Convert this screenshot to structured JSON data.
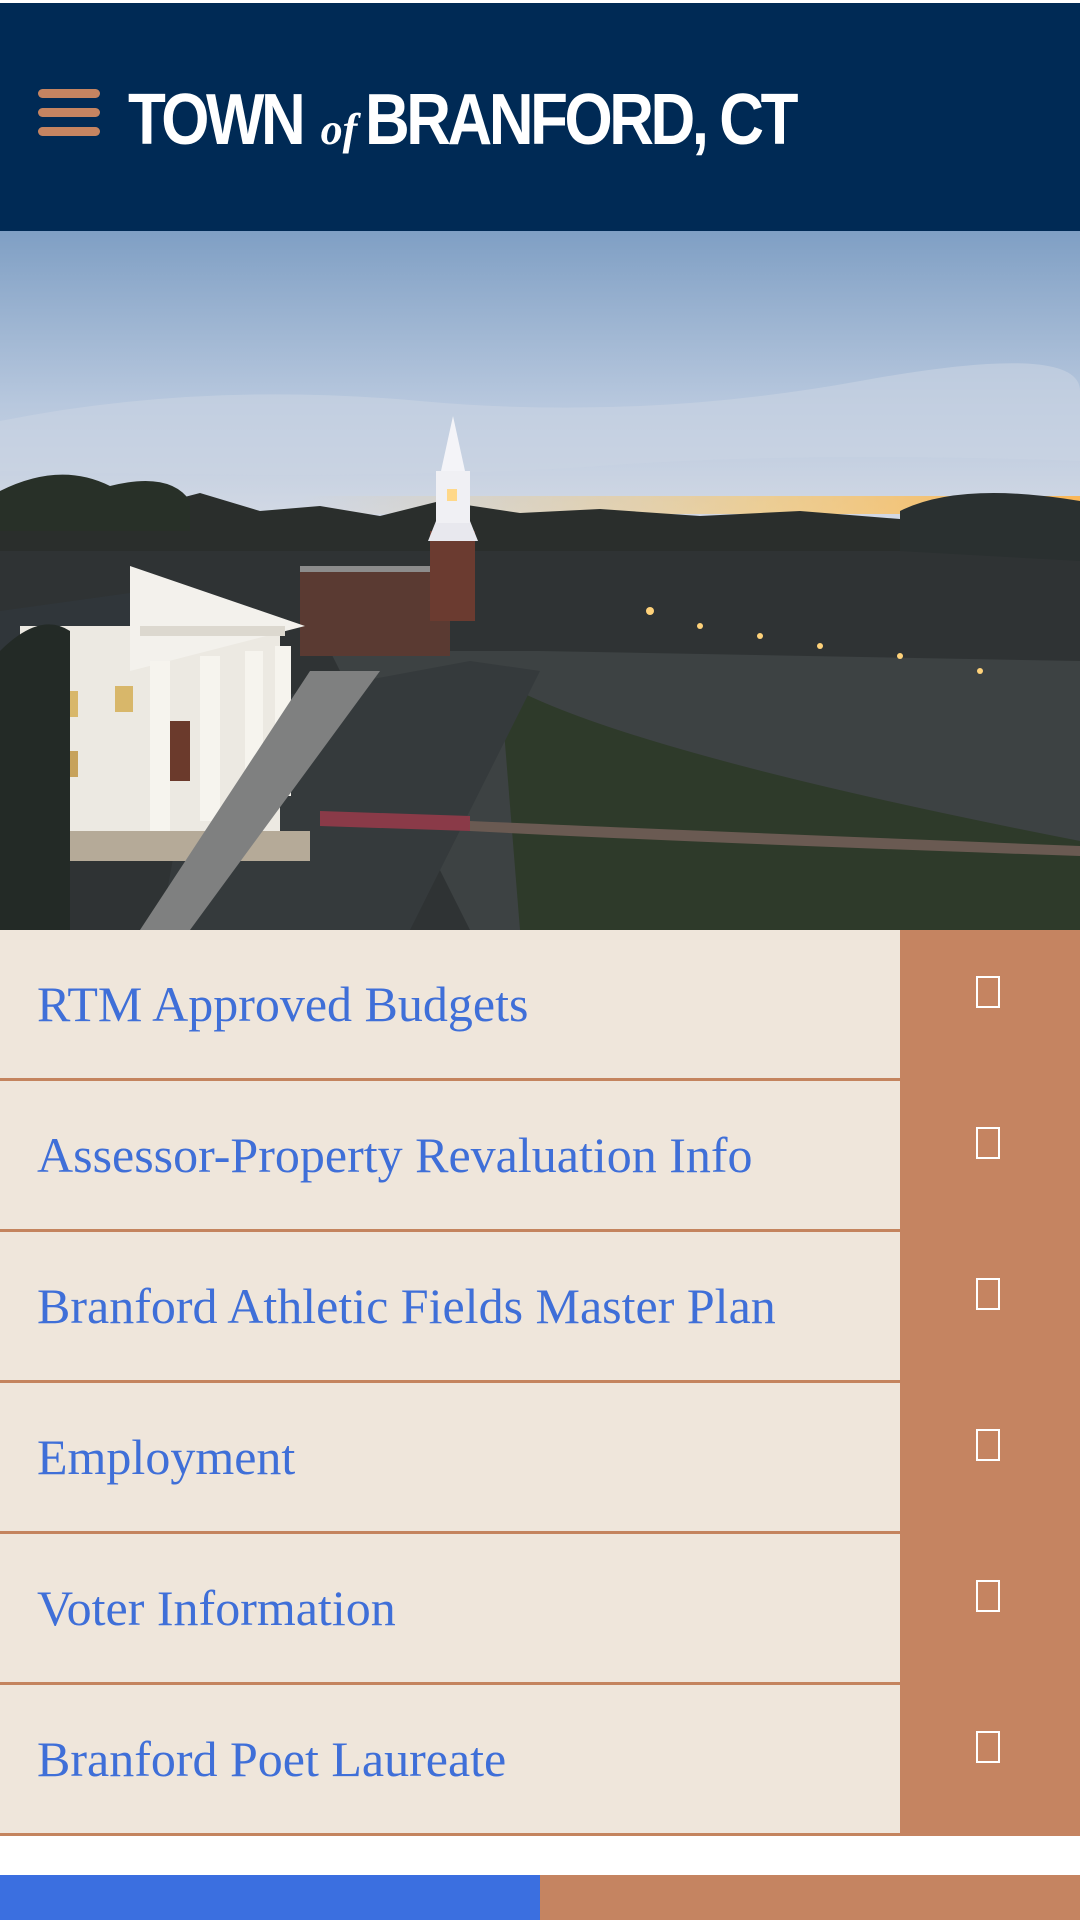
{
  "header": {
    "logo": {
      "town": "TOWN",
      "of": "of",
      "name": "BRANFORD, CT"
    },
    "menu_icon": "hamburger-menu-icon"
  },
  "hero": {
    "alt": "Aerial view of Branford town green at sunset"
  },
  "quick_links": [
    {
      "label": "RTM Approved Budgets"
    },
    {
      "label": "Assessor-Property Revaluation Info"
    },
    {
      "label": "Branford Athletic Fields Master Plan"
    },
    {
      "label": "Employment"
    },
    {
      "label": "Voter Information"
    },
    {
      "label": "Branford Poet Laureate"
    }
  ],
  "colors": {
    "navy": "#002a55",
    "accent": "#c58461",
    "cream": "#efe6db",
    "link": "#3f6fd8"
  }
}
